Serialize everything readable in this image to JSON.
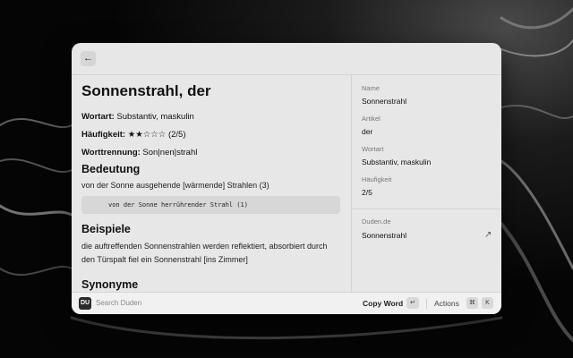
{
  "window": {
    "back_icon": "arrow-left-icon",
    "left": {
      "title": "Sonnenstrahl, der",
      "wortart_label": "Wortart:",
      "wortart_value": "Substantiv, maskulin",
      "haeufigkeit_label": "Häufigkeit:",
      "haeufigkeit_stars": "★★☆☆☆",
      "haeufigkeit_value": "(2/5)",
      "worttrennung_label": "Worttrennung:",
      "worttrennung_value": "Son|nen|strahl",
      "bedeutung_heading": "Bedeutung",
      "bedeutung_text": "von der Sonne ausgehende [wärmende] Strahlen (3)",
      "example_code": "von der Sonne herrührender Strahl (1)",
      "beispiele_heading": "Beispiele",
      "beispiele_text": "die auftreffenden Sonnenstrahlen werden reflektiert, absorbiert durch den Türspalt fiel ein Sonnenstrahl [ins Zimmer]",
      "synonyme_heading": "Synonyme"
    },
    "right": {
      "name_label": "Name",
      "name_value": "Sonnenstrahl",
      "artikel_label": "Artikel",
      "artikel_value": "der",
      "wortart_label": "Wortart",
      "wortart_value": "Substantiv, maskulin",
      "haeufigkeit_label": "Häufigkeit",
      "haeufigkeit_value": "2/5",
      "link_label": "Duden.de",
      "link_value": "Sonnenstrahl",
      "link_icon": "external-arrow-icon"
    }
  },
  "bottombar": {
    "logo": "DU",
    "search_placeholder": "Search Duden",
    "copy_label": "Copy Word",
    "copy_key": "↵",
    "actions_label": "Actions",
    "cmd_key": "⌘",
    "k_key": "K"
  }
}
